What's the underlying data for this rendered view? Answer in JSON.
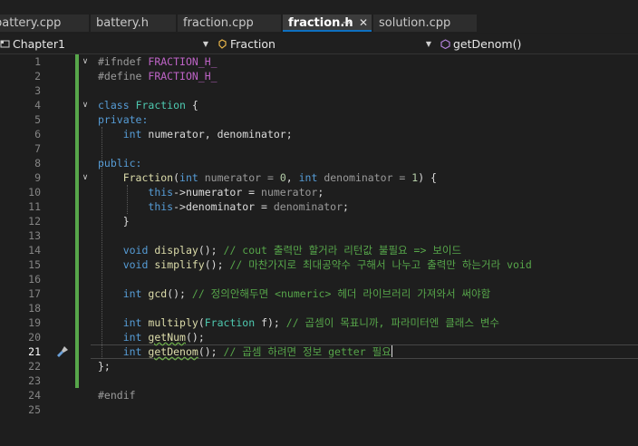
{
  "tabs": [
    {
      "label": "battery.cpp",
      "active": false
    },
    {
      "label": "battery.h",
      "active": false
    },
    {
      "label": "fraction.cpp",
      "active": false
    },
    {
      "label": "fraction.h",
      "active": true,
      "pin_icon": "pin-icon",
      "close_icon": "close-icon"
    },
    {
      "label": "solution.cpp",
      "active": false
    }
  ],
  "nav": {
    "project": "Chapter1",
    "class": "Fraction",
    "member": "getDenom()"
  },
  "editor": {
    "current_line": 21,
    "line_numbers": [
      "1",
      "2",
      "3",
      "4",
      "5",
      "6",
      "7",
      "8",
      "9",
      "10",
      "11",
      "12",
      "13",
      "14",
      "15",
      "16",
      "17",
      "18",
      "19",
      "20",
      "21",
      "22",
      "23",
      "24",
      "25"
    ],
    "lines": [
      {
        "n": 1,
        "text": "#ifndef FRACTION_H_"
      },
      {
        "n": 2,
        "text": "#define FRACTION_H_"
      },
      {
        "n": 3,
        "text": ""
      },
      {
        "n": 4,
        "text": "class Fraction {"
      },
      {
        "n": 5,
        "text": "private:"
      },
      {
        "n": 6,
        "text": "    int numerator, denominator;"
      },
      {
        "n": 7,
        "text": ""
      },
      {
        "n": 8,
        "text": "public:"
      },
      {
        "n": 9,
        "text": "    Fraction(int numerator = 0, int denominator = 1) {"
      },
      {
        "n": 10,
        "text": "        this->numerator = numerator;"
      },
      {
        "n": 11,
        "text": "        this->denominator = denominator;"
      },
      {
        "n": 12,
        "text": "    }"
      },
      {
        "n": 13,
        "text": ""
      },
      {
        "n": 14,
        "text": "    void display(); // cout 출력만 할거라 리턴값 불필요 => 보이드"
      },
      {
        "n": 15,
        "text": "    void simplify(); // 마찬가지로 최대공약수 구해서 나누고 출력만 하는거라 void"
      },
      {
        "n": 16,
        "text": ""
      },
      {
        "n": 17,
        "text": "    int gcd(); // 정의안해두면 <numeric> 헤더 라이브러리 가져와서 써야함"
      },
      {
        "n": 18,
        "text": ""
      },
      {
        "n": 19,
        "text": "    int multiply(Fraction f); // 곱셈이 목표니까, 파라미터엔 클래스 변수"
      },
      {
        "n": 20,
        "text": "    int getNum();"
      },
      {
        "n": 21,
        "text": "    int getDenom(); // 곱셈 하려면 정보 getter 필요"
      },
      {
        "n": 22,
        "text": "};"
      },
      {
        "n": 23,
        "text": ""
      },
      {
        "n": 24,
        "text": "#endif"
      },
      {
        "n": 25,
        "text": ""
      }
    ],
    "tokens": {
      "ifndef": "#ifndef",
      "define": "#define",
      "endif": "#endif",
      "macro": "FRACTION_H_",
      "class_kw": "class",
      "class_name": "Fraction",
      "brace_open": " {",
      "private": "private:",
      "int": "int",
      "void": "void",
      "fields": " numerator, denominator;",
      "public": "public:",
      "ctor_open": "(",
      "param_num": " numerator = ",
      "zero": "0",
      "comma": ", ",
      "param_den": " denominator = ",
      "one": "1",
      "ctor_close": ") {",
      "this": "this",
      "assign_num": "->numerator = ",
      "numerator": "numerator",
      "assign_den": "->denominator = ",
      "denominator": "denominator",
      "semi": ";",
      "close_brace": "}",
      "end_class": "};",
      "display": "display",
      "simplify": "simplify",
      "gcd": "gcd",
      "multiply": "multiply",
      "getNum": "getNum",
      "getDenom": "getDenom",
      "empty_call": "();",
      "mult_open": "(",
      "mult_param": " f);",
      "cmt14": " // cout 출력만 할거라 리턴값 불필요 => 보이드",
      "cmt15": " // 마찬가지로 최대공약수 구해서 나누고 출력만 하는거라 void",
      "cmt17": " // 정의안해두면 <numeric> 헤더 라이브러리 가져와서 써야함",
      "cmt19": " // 곱셈이 목표니까, 파라미터엔 클래스 변수",
      "cmt21": " // 곱셈 하려면 정보 getter 필요"
    }
  },
  "colors": {
    "background": "#1e1e1e",
    "keyword": "#569cd6",
    "type": "#4ec9b0",
    "function": "#dcdcaa",
    "comment": "#57a64a",
    "macro": "#bd63c5",
    "accent": "#0e70c0",
    "change_bar": "#57a64a"
  }
}
